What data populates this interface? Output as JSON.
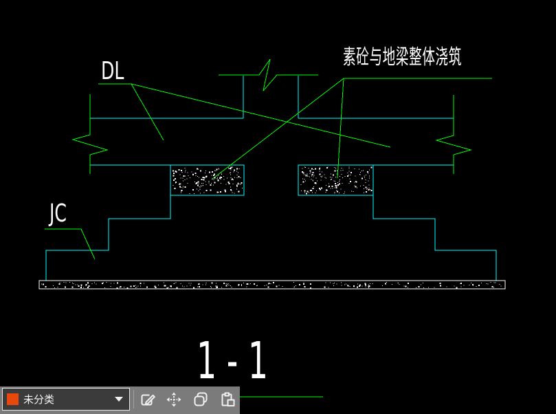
{
  "canvas": {
    "background": "#000000",
    "colors": {
      "annotation_line": "#00ff00",
      "structure_line": "#00ffff",
      "hatch": "#ffffff",
      "text": "#ffffff"
    },
    "labels": {
      "beam": "DL",
      "foundation": "JC",
      "note": "素砼与地梁整体浇筑",
      "section": "1 - 1"
    }
  },
  "toolbar": {
    "background": "#7b7b7b",
    "category": {
      "label": "未分类",
      "swatch_color": "#e8480c",
      "chevron_icon": "chevron-down-icon"
    },
    "buttons": [
      {
        "icon": "edit-icon"
      },
      {
        "icon": "move-icon"
      },
      {
        "icon": "copy-icon"
      },
      {
        "icon": "paste-icon"
      }
    ]
  }
}
